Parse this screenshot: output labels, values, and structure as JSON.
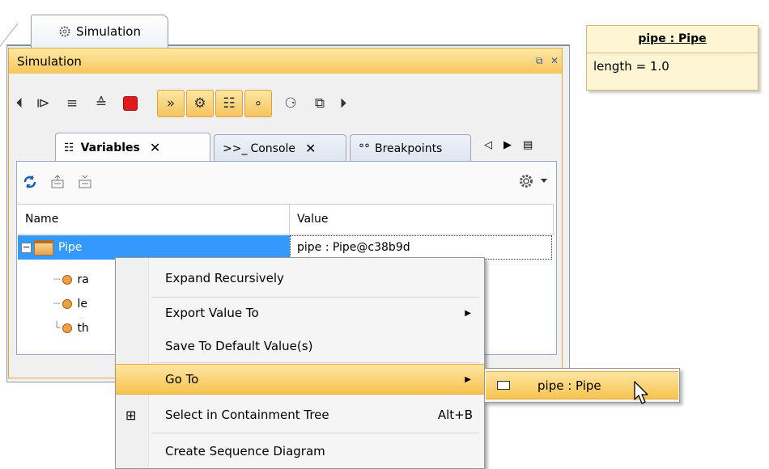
{
  "window": {
    "outer_tab_label": "Simulation",
    "panel_title": "Simulation",
    "restore_glyph": "⧉",
    "close_glyph": "✕"
  },
  "toolbar": {
    "items": [
      {
        "icon": "back-icon",
        "glyph": "⏴"
      },
      {
        "icon": "step-into-icon",
        "glyph": "⧐"
      },
      {
        "icon": "step-over-icon",
        "glyph": "≡"
      },
      {
        "icon": "step-out-icon",
        "glyph": "≙"
      },
      {
        "icon": "stop-icon",
        "glyph": ""
      },
      {
        "icon": "console-toggle-icon",
        "glyph": "»"
      },
      {
        "icon": "sim-config-icon",
        "glyph": "⚙"
      },
      {
        "icon": "variables-toggle-icon",
        "glyph": "☷"
      },
      {
        "icon": "breakpoints-toggle-icon",
        "glyph": "∘"
      },
      {
        "icon": "trigger-icon",
        "glyph": "⚆"
      },
      {
        "icon": "export-icon",
        "glyph": "⧉"
      },
      {
        "icon": "forward-icon",
        "glyph": "⏵"
      }
    ]
  },
  "tabs": [
    {
      "label": "Variables",
      "icon_glyph": "☷",
      "close": "✕"
    },
    {
      "label": "Console",
      "icon_glyph": ">>_",
      "close": "✕"
    },
    {
      "label": "Breakpoints",
      "icon_glyph": "°°"
    }
  ],
  "tab_nav": {
    "left": "◁",
    "right": "▶",
    "menu": "▤"
  },
  "variables": {
    "col_name": "Name",
    "col_value": "Value",
    "rows": [
      {
        "name": "Pipe",
        "value": "pipe : Pipe@c38b9d"
      },
      {
        "name": "ra"
      },
      {
        "name": "le"
      },
      {
        "name": "th"
      }
    ]
  },
  "note": {
    "header": "pipe : Pipe",
    "attr": "length = 1.0"
  },
  "context_menu": {
    "items": [
      {
        "label": "Expand Recursively"
      },
      {
        "label": "Export Value To",
        "arrow": "▶"
      },
      {
        "label": "Save To Default Value(s)"
      },
      {
        "label": "Go To",
        "arrow": "▶"
      },
      {
        "label": "Select in Containment Tree",
        "shortcut": "Alt+B"
      },
      {
        "label": "Create Sequence Diagram"
      }
    ],
    "submenu": {
      "label": "pipe : Pipe"
    }
  },
  "colors": {
    "selection": "#3399ff",
    "highlight": "#f7c34f",
    "panel_title": "#f8c65c"
  }
}
